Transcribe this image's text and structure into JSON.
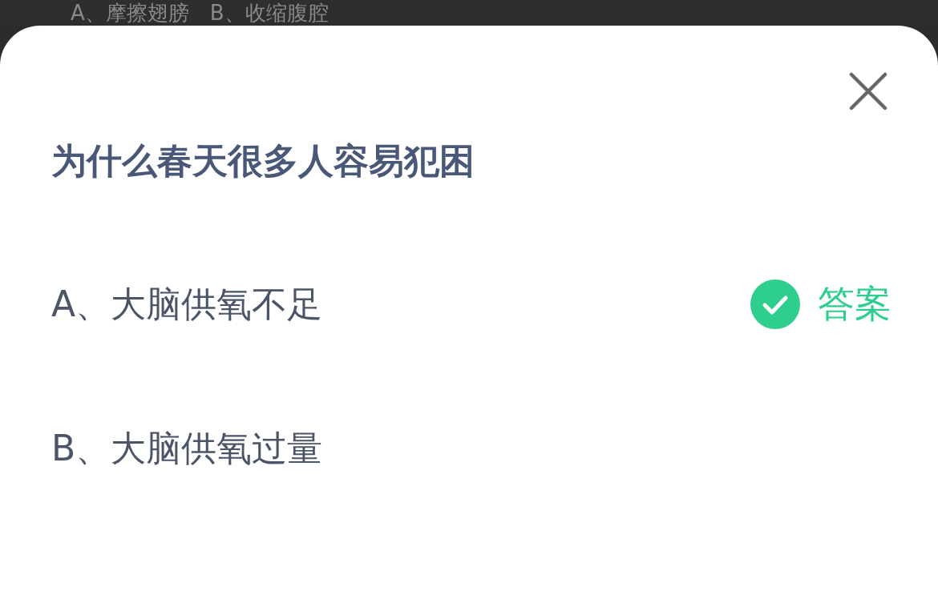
{
  "background": {
    "options_text": "A、摩擦翅膀　B、收缩腹腔"
  },
  "dialog": {
    "question": "为什么春天很多人容易犯困",
    "answer_label": "答案",
    "options": [
      {
        "label": "A、大脑供氧不足",
        "correct": true
      },
      {
        "label": "B、大脑供氧过量",
        "correct": false
      }
    ]
  }
}
